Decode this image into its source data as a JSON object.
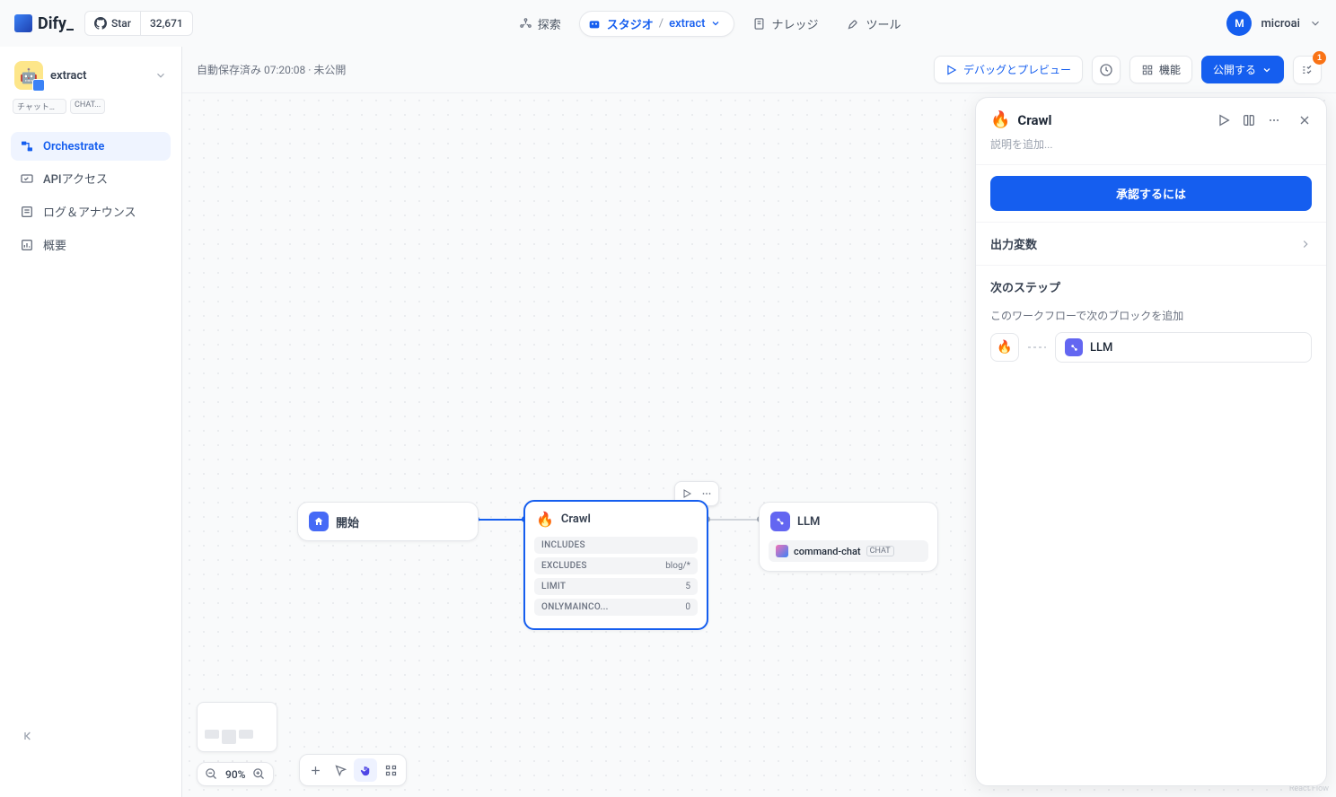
{
  "brand": "Dify_",
  "github": {
    "star_label": "Star",
    "count": "32,671"
  },
  "nav": {
    "explore": "探索",
    "studio": "スタジオ",
    "app": "extract",
    "knowledge": "ナレッジ",
    "tools": "ツール"
  },
  "user": {
    "initial": "M",
    "name": "microai"
  },
  "sidebar": {
    "app_name": "extract",
    "tags": [
      "チャットボット",
      "CHAT..."
    ],
    "items": [
      "Orchestrate",
      "APIアクセス",
      "ログ＆アナウンス",
      "概要"
    ]
  },
  "toolbar": {
    "status": "自動保存済み 07:20:08 · 未公開",
    "debug": "デバッグとプレビュー",
    "features": "機能",
    "publish": "公開する"
  },
  "nodes": {
    "start": {
      "title": "開始"
    },
    "crawl": {
      "title": "Crawl",
      "params": [
        {
          "k": "INCLUDES",
          "v": ""
        },
        {
          "k": "EXCLUDES",
          "v": "blog/*"
        },
        {
          "k": "LIMIT",
          "v": "5"
        },
        {
          "k": "ONLYMAINCO...",
          "v": "0"
        }
      ]
    },
    "llm": {
      "title": "LLM",
      "model": "command-chat",
      "model_tag": "CHAT"
    }
  },
  "zoom": "90%",
  "panel": {
    "title": "Crawl",
    "desc_placeholder": "説明を追加...",
    "approve_btn": "承認するには",
    "output_vars": "出力変数",
    "next_step": "次のステップ",
    "next_desc": "このワークフローで次のブロックを追加",
    "next_block": "LLM"
  },
  "react_flow": "React Flow"
}
